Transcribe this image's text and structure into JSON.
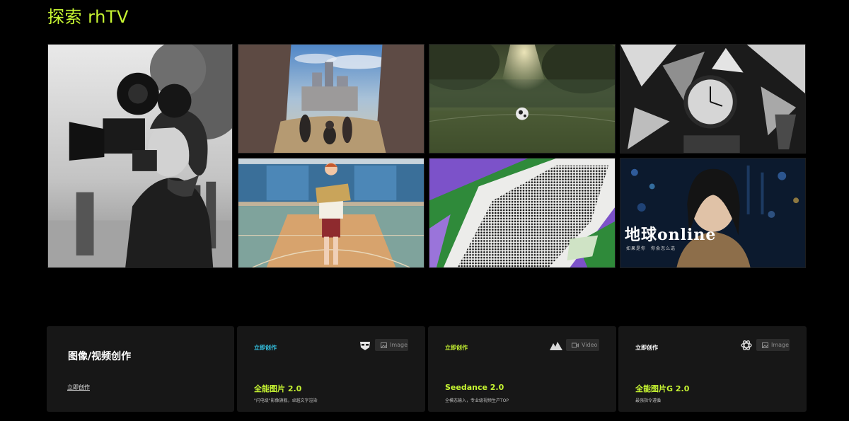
{
  "page": {
    "title": "探索 rhTV"
  },
  "gallery": {
    "tiles": [
      {
        "subject": "vintage woman with film camera"
      },
      {
        "subject": "fantasy ruined city canyon"
      },
      {
        "subject": "soccer ball in sunlit field"
      },
      {
        "subject": "expressionist clock interior"
      },
      {
        "subject": "boy reading in gym"
      },
      {
        "subject": "abstract torn paper halftone"
      },
      {
        "subject": "woman with city lights poster",
        "poster_title": "地球online",
        "poster_subtitle": "如果是你　你会怎么选"
      }
    ]
  },
  "intro": {
    "title": "图像/视频创作",
    "link": "立即创作"
  },
  "cards": [
    {
      "tag": "立即创作",
      "tag_color": "#35c6e6",
      "icon": "alien-mask-icon",
      "badge": "Image",
      "badge_icon": "image-icon",
      "name": "全能图片 2.0",
      "desc": "\"闪电级\"影像旗舰，卓越文字渲染"
    },
    {
      "tag": "立即创作",
      "tag_color": "#c6f432",
      "icon": "mountain-peaks-icon",
      "badge": "Video",
      "badge_icon": "video-icon",
      "name": "Seedance 2.0",
      "desc": "全模态输入，专业级视频生产TOP"
    },
    {
      "tag": "立即创作",
      "tag_color": "#ffffff",
      "icon": "openai-knot-icon",
      "badge": "Image",
      "badge_icon": "image-icon",
      "name": "全能图片G 2.0",
      "desc": "最强指令遵循"
    }
  ],
  "colors": {
    "accent": "#c6f432",
    "card_bg": "#171717",
    "badge_bg": "#2c2c2c"
  }
}
